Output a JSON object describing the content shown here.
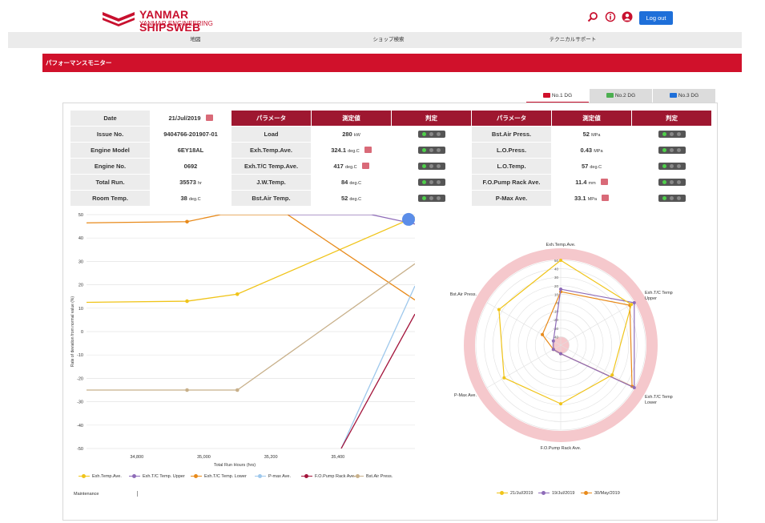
{
  "header": {
    "brand": "YANMAR SHIPSWEB",
    "brand_sub": "YANMAR ENGINEERING",
    "logout_label": "Log out"
  },
  "nav": {
    "items": [
      "地図",
      "ショップ検索",
      "テクニカルサポート"
    ]
  },
  "page_title": "パフォーマンスモニター",
  "tabs": [
    {
      "label": "No.1 DG",
      "color": "#d0112b",
      "active": true
    },
    {
      "label": "No.2 DG",
      "color": "#4caf50",
      "active": false
    },
    {
      "label": "No.3 DG",
      "color": "#1e6fd9",
      "active": false
    }
  ],
  "info": {
    "date_label": "Date",
    "date_value": "21/Jul/2019",
    "issue_label": "Issue No.",
    "issue_value": "9404766-201907-01",
    "model_label": "Engine Model",
    "model_value": "6EY18AL",
    "engine_label": "Engine No.",
    "engine_value": "0692",
    "run_label": "Total Run.",
    "run_value": "35573",
    "run_unit": "hr",
    "room_label": "Room Temp.",
    "room_value": "38",
    "room_unit": "deg.C"
  },
  "params_headers": {
    "param": "パラメータ",
    "value": "測定値",
    "judge": "判定"
  },
  "params_left": [
    {
      "name": "Load",
      "value": "280",
      "unit": "kW",
      "alert": false
    },
    {
      "name": "Exh.Temp.Ave.",
      "value": "324.1",
      "unit": "deg.C",
      "alert": true
    },
    {
      "name": "Exh.T/C Temp.Ave.",
      "value": "417",
      "unit": "deg.C",
      "alert": true
    },
    {
      "name": "J.W.Temp.",
      "value": "84",
      "unit": "deg.C",
      "alert": false
    },
    {
      "name": "Bst.Air Temp.",
      "value": "52",
      "unit": "deg.C",
      "alert": false
    }
  ],
  "params_right": [
    {
      "name": "Bst.Air Press.",
      "value": "52",
      "unit": "MPa",
      "alert": false
    },
    {
      "name": "L.O.Press.",
      "value": "0.43",
      "unit": "MPa",
      "alert": false
    },
    {
      "name": "L.O.Temp.",
      "value": "57",
      "unit": "deg.C",
      "alert": false
    },
    {
      "name": "F.O.Pump Rack Ave.",
      "value": "11.4",
      "unit": "mm",
      "alert": true
    },
    {
      "name": "P-Max Ave.",
      "value": "33.1",
      "unit": "MPa",
      "alert": true
    }
  ],
  "maintenance_label": "Maintenance",
  "chart_data": [
    {
      "type": "line",
      "xlabel": "Total Run Hours (hrs)",
      "ylabel": "Rate of deviation from normal value (%)",
      "xlim": [
        34650,
        35630
      ],
      "ylim": [
        -50,
        50
      ],
      "xticks": [
        34800,
        35000,
        35200,
        35400
      ],
      "xtick_labels": [
        "34,800",
        "35,000",
        "35,200",
        "35,400"
      ],
      "yticks": [
        50,
        40,
        30,
        20,
        10,
        0,
        -10,
        -20,
        -30,
        -40,
        -50
      ],
      "series": [
        {
          "name": "Exh.Temp.Ave.",
          "color": "#f0c419",
          "points": [
            [
              34650,
              12.5
            ],
            [
              34950,
              13
            ],
            [
              35100,
              16
            ],
            [
              35630,
              49
            ]
          ]
        },
        {
          "name": "Exh.T/C Temp. Upper",
          "color": "#8e6bb8",
          "points": [
            [
              35250,
              50
            ],
            [
              35500,
              50
            ],
            [
              35630,
              46
            ]
          ]
        },
        {
          "name": "Exh.T/C Temp. Lower",
          "color": "#e88a1a",
          "points": [
            [
              34650,
              46.5
            ],
            [
              34950,
              47
            ],
            [
              35050,
              50
            ],
            [
              35250,
              50
            ],
            [
              35630,
              13.5
            ]
          ]
        },
        {
          "name": "P-max Ave.",
          "color": "#9ec8ec",
          "points": [
            [
              35410,
              -50
            ],
            [
              35630,
              19.5
            ]
          ]
        },
        {
          "name": "F.O.Pump Rack Ave.",
          "color": "#a3143b",
          "points": [
            [
              35410,
              -50
            ],
            [
              35630,
              7.5
            ]
          ]
        },
        {
          "name": "Bst.Air Press.",
          "color": "#c8b08a",
          "points": [
            [
              34650,
              -25
            ],
            [
              34950,
              -25
            ],
            [
              35100,
              -25
            ],
            [
              35630,
              29
            ]
          ]
        }
      ]
    },
    {
      "type": "radar",
      "axes": [
        "Exh.Temp.Ave.",
        "Exh.T/C Temp Upper",
        "Exh.T/C Temp Lower",
        "F.O.Pump Rack Ave.",
        "P-Max Ave.",
        "Bst.Air Press."
      ],
      "rlim": [
        -50,
        50
      ],
      "rticks": [
        50,
        40,
        30,
        20,
        10,
        0,
        -10,
        -20,
        -30,
        -40,
        -50
      ],
      "series": [
        {
          "name": "21/Jul/2019",
          "color": "#f0c419",
          "values": [
            50,
            46,
            20,
            19,
            27,
            34
          ]
        },
        {
          "name": "19/Jul/2019",
          "color": "#8e6bb8",
          "values": [
            16,
            50,
            50,
            -40,
            -40,
            -40
          ]
        },
        {
          "name": "30/May/2019",
          "color": "#e88a1a",
          "values": [
            13,
            44,
            47,
            -40,
            -40,
            -25
          ]
        }
      ]
    }
  ]
}
